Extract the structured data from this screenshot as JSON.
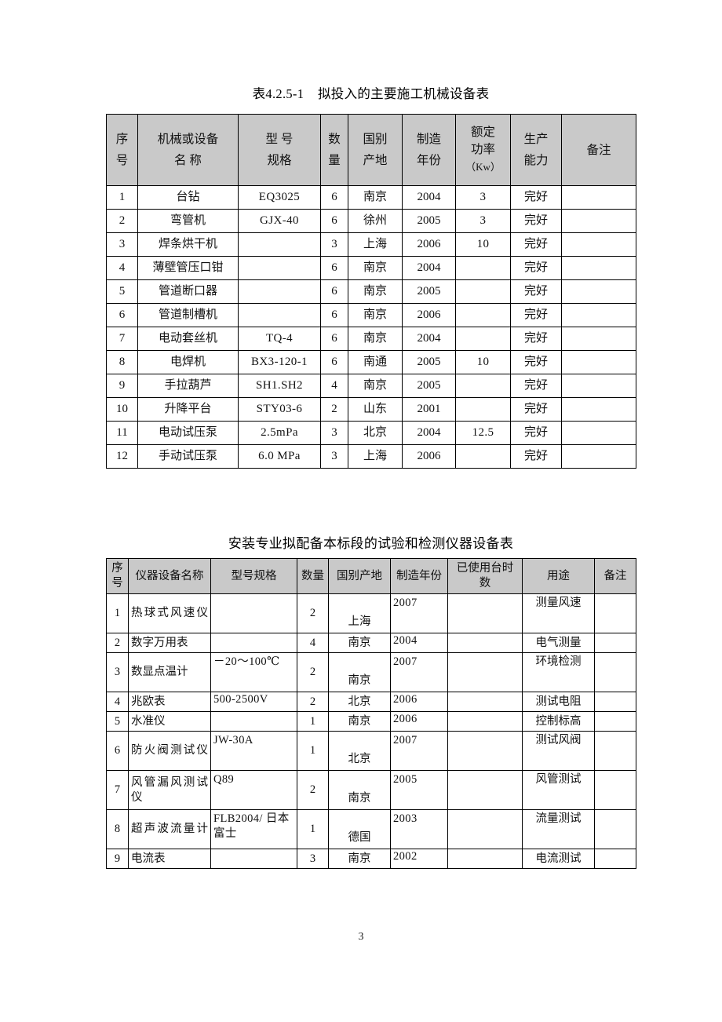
{
  "page": {
    "page_number": "3"
  },
  "table1": {
    "title": "表4.2.5-1    拟投入的主要施工机械设备表",
    "headers": {
      "seq_l1": "序",
      "seq_l2": "号",
      "name_l1": "机械或设备",
      "name_l2": "名        称",
      "model_l1": "型 号",
      "model_l2": "规格",
      "qty_l1": "数",
      "qty_l2": "量",
      "origin_l1": "国别",
      "origin_l2": "产地",
      "year_l1": "制造",
      "year_l2": "年份",
      "power_l1": "额定",
      "power_l2": "功率",
      "power_l3": "（Kw）",
      "capacity_l1": "生产",
      "capacity_l2": "能力",
      "remark": "备注"
    },
    "rows": [
      {
        "seq": "1",
        "name": "台钻",
        "model": "EQ3025",
        "qty": "6",
        "origin": "南京",
        "year": "2004",
        "power": "3",
        "capacity": "完好",
        "remark": ""
      },
      {
        "seq": "2",
        "name": "弯管机",
        "model": "GJX-40",
        "qty": "6",
        "origin": "徐州",
        "year": "2005",
        "power": "3",
        "capacity": "完好",
        "remark": ""
      },
      {
        "seq": "3",
        "name": "焊条烘干机",
        "model": "",
        "qty": "3",
        "origin": "上海",
        "year": "2006",
        "power": "10",
        "capacity": "完好",
        "remark": ""
      },
      {
        "seq": "4",
        "name": "薄壁管压口钳",
        "model": "",
        "qty": "6",
        "origin": "南京",
        "year": "2004",
        "power": "",
        "capacity": "完好",
        "remark": ""
      },
      {
        "seq": "5",
        "name": "管道断口器",
        "model": "",
        "qty": "6",
        "origin": "南京",
        "year": "2005",
        "power": "",
        "capacity": "完好",
        "remark": ""
      },
      {
        "seq": "6",
        "name": "管道制槽机",
        "model": "",
        "qty": "6",
        "origin": "南京",
        "year": "2006",
        "power": "",
        "capacity": "完好",
        "remark": ""
      },
      {
        "seq": "7",
        "name": "电动套丝机",
        "model": "TQ-4",
        "qty": "6",
        "origin": "南京",
        "year": "2004",
        "power": "",
        "capacity": "完好",
        "remark": ""
      },
      {
        "seq": "8",
        "name": "电焊机",
        "model": "BX3-120-1",
        "qty": "6",
        "origin": "南通",
        "year": "2005",
        "power": "10",
        "capacity": "完好",
        "remark": ""
      },
      {
        "seq": "9",
        "name": "手拉葫芦",
        "model": "SH1.SH2",
        "qty": "4",
        "origin": "南京",
        "year": "2005",
        "power": "",
        "capacity": "完好",
        "remark": ""
      },
      {
        "seq": "10",
        "name": "升降平台",
        "model": "STY03-6",
        "qty": "2",
        "origin": "山东",
        "year": "2001",
        "power": "",
        "capacity": "完好",
        "remark": ""
      },
      {
        "seq": "11",
        "name": "电动试压泵",
        "model": "2.5mPa",
        "qty": "3",
        "origin": "北京",
        "year": "2004",
        "power": "12.5",
        "capacity": "完好",
        "remark": ""
      },
      {
        "seq": "12",
        "name": "手动试压泵",
        "model": "6.0 MPa",
        "qty": "3",
        "origin": "上海",
        "year": "2006",
        "power": "",
        "capacity": "完好",
        "remark": ""
      }
    ]
  },
  "table2": {
    "title": "安装专业拟配备本标段的试验和检测仪器设备表",
    "headers": {
      "seq_l1": "序",
      "seq_l2": "号",
      "name": "仪器设备名称",
      "model": "型号规格",
      "qty": "数量",
      "origin": "国别产地",
      "year": "制造年份",
      "hours_l1": "已使用台时",
      "hours_l2": "数",
      "usage": "用途",
      "remark": "备注"
    },
    "rows": [
      {
        "seq": "1",
        "name": "热球式风速仪",
        "model": "",
        "qty": "2",
        "origin": "上海",
        "year": "2007",
        "hours": "",
        "usage": "测量风速",
        "remark": "",
        "tall": true
      },
      {
        "seq": "2",
        "name": "数字万用表",
        "model": "",
        "qty": "4",
        "origin": "南京",
        "year": "2004",
        "hours": "",
        "usage": "电气测量",
        "remark": "",
        "tall": false
      },
      {
        "seq": "3",
        "name": "数显点温计",
        "model": "－20～100℃",
        "qty": "2",
        "origin": "南京",
        "year": "2007",
        "hours": "",
        "usage": "环境检测",
        "remark": "",
        "tall": true
      },
      {
        "seq": "4",
        "name": "兆欧表",
        "model": "500-2500V",
        "qty": "2",
        "origin": "北京",
        "year": "2006",
        "hours": "",
        "usage": "测试电阻",
        "remark": "",
        "tall": false
      },
      {
        "seq": "5",
        "name": "水准仪",
        "model": "",
        "qty": "1",
        "origin": "南京",
        "year": "2006",
        "hours": "",
        "usage": "控制标高",
        "remark": "",
        "tall": false
      },
      {
        "seq": "6",
        "name": "防火阀测试仪",
        "model": "JW-30A",
        "qty": "1",
        "origin": "北京",
        "year": "2007",
        "hours": "",
        "usage": "测试风阀",
        "remark": "",
        "tall": true
      },
      {
        "seq": "7",
        "name": "风管漏风测试仪",
        "model": "Q89",
        "qty": "2",
        "origin": "南京",
        "year": "2005",
        "hours": "",
        "usage": "风管测试",
        "remark": "",
        "tall": true
      },
      {
        "seq": "8",
        "name": "超声波流量计",
        "model": "FLB2004/ 日本富士",
        "qty": "1",
        "origin": "德国",
        "year": "2003",
        "hours": "",
        "usage": "流量测试",
        "remark": "",
        "tall": true
      },
      {
        "seq": "9",
        "name": "电流表",
        "model": "",
        "qty": "3",
        "origin": "南京",
        "year": "2002",
        "hours": "",
        "usage": "电流测试",
        "remark": "",
        "tall": false
      }
    ]
  }
}
